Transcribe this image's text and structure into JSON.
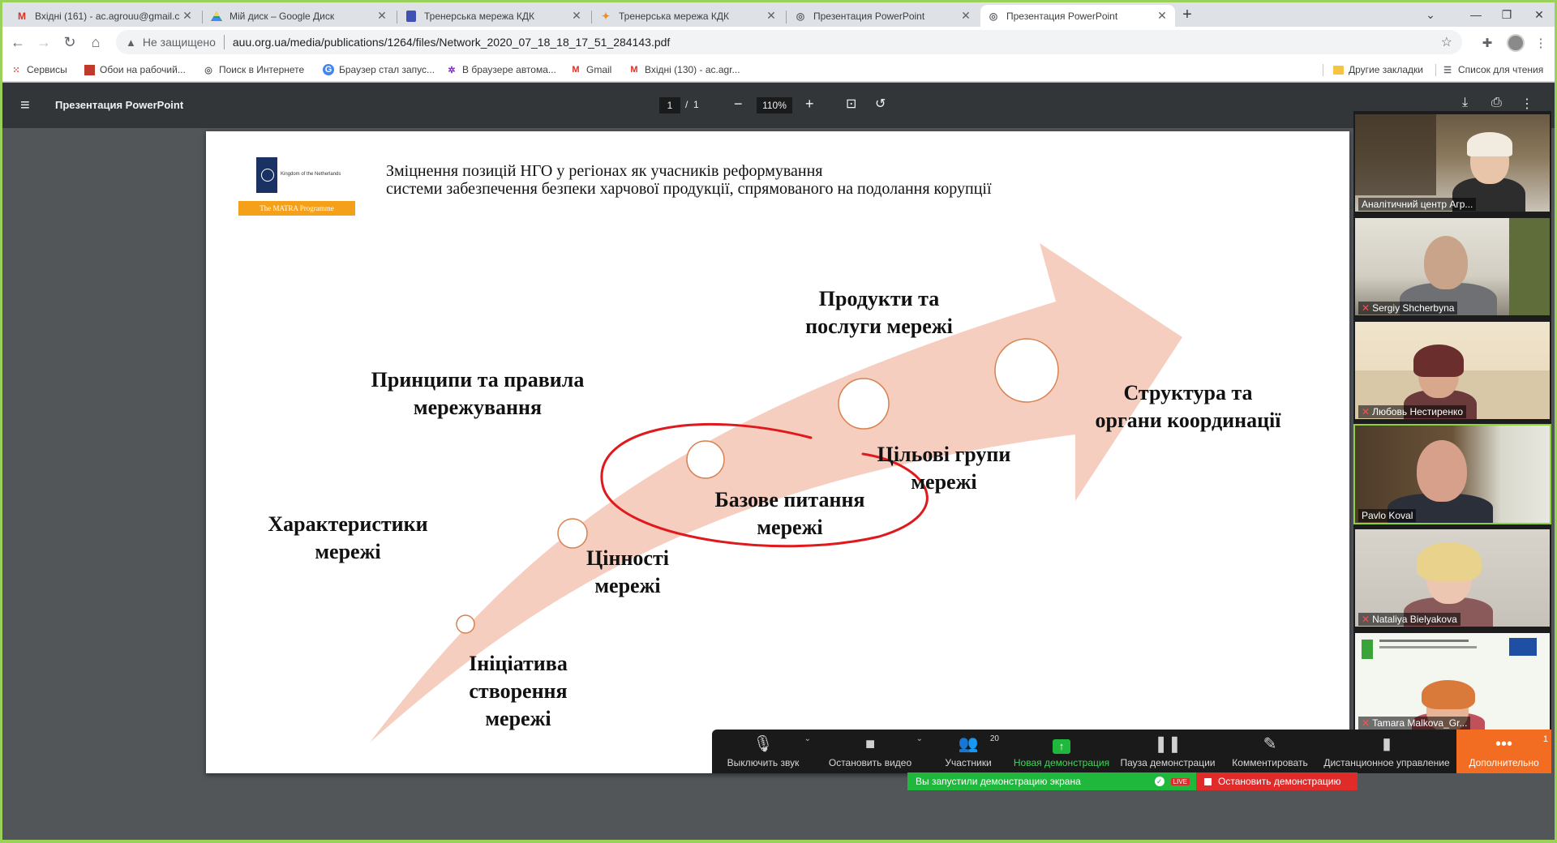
{
  "browser": {
    "tabs": [
      {
        "title": "Вхідні (161) - ac.agrouu@gmail.c",
        "icon": "gmail-icon"
      },
      {
        "title": "Мій диск – Google Диск",
        "icon": "google-drive-icon"
      },
      {
        "title": "Тренерська мережа КДК",
        "icon": "google-forms-icon"
      },
      {
        "title": "Тренерська мережа КДК",
        "icon": "site-icon"
      },
      {
        "title": "Презентация PowerPoint",
        "icon": "globe-icon"
      },
      {
        "title": "Презентация PowerPoint",
        "icon": "globe-icon"
      }
    ],
    "new_tab": "+",
    "security_label": "Не защищено",
    "url": "auu.org.ua/media/publications/1264/files/Network_2020_07_18_18_17_51_284143.pdf",
    "bookmarks": [
      {
        "label": "Сервисы",
        "icon": "apps-grid-icon"
      },
      {
        "label": "Обои на рабочий...",
        "icon": "bookmark-image-icon"
      },
      {
        "label": "Поиск в Интернете",
        "icon": "globe-icon"
      },
      {
        "label": "Браузер стал запус...",
        "icon": "google-icon"
      },
      {
        "label": "В браузере автома...",
        "icon": "virus-icon"
      },
      {
        "label": "Gmail",
        "icon": "gmail-icon"
      },
      {
        "label": "Вхідні (130) - ac.agr...",
        "icon": "gmail-icon"
      }
    ],
    "other_bookmarks": "Другие закладки",
    "reading_list": "Список для чтения"
  },
  "pdf_viewer": {
    "title": "Презентация PowerPoint",
    "page_current": "1",
    "page_sep": "/",
    "page_total": "1",
    "zoom": "110%"
  },
  "slide": {
    "header_line1": "Зміцнення позицій НГО у регіонах як учасників реформування",
    "header_line2": "системи забезпечення безпеки харчової продукції, спрямованого на подолання корупції",
    "logo_text": "Kingdom of the Netherlands",
    "logo_banner": "The MATRA Programme",
    "labels": {
      "initiative": "Ініціатива\nстворення\nмережі",
      "characteristics": "Характеристики\nмережі",
      "values": "Цінності\nмережі",
      "basic_nutrition": "Базове питання\nмережі",
      "principles": "Принципи та правила\nмережування",
      "target_groups": "Цільові групи\nмережі",
      "products": "Продукти та\nпослуги мережі",
      "structure": "Структура та\nоргани координації"
    }
  },
  "zoom": {
    "participants": [
      {
        "name": "Аналітичний центр Агр...",
        "muted": false
      },
      {
        "name": "Sergiy Shcherbyna",
        "muted": true
      },
      {
        "name": "Любовь Нестиренко",
        "muted": true
      },
      {
        "name": "Pavlo Koval",
        "muted": false
      },
      {
        "name": "Nataliya Bielyakova",
        "muted": true
      },
      {
        "name": "Tamara Malkova_Gr...",
        "muted": true
      }
    ],
    "controls": {
      "mute": "Выключить звук",
      "stop_video": "Остановить видео",
      "participants": "Участники",
      "participants_count": "20",
      "new_share": "Новая демонстрация",
      "pause_share": "Пауза демонстрации",
      "annotate": "Комментировать",
      "remote_control": "Дистанционное управление",
      "more": "Дополнительно",
      "more_badge": "1"
    },
    "share_notice": "Вы запустили демонстрацию экрана",
    "live_badge": "LIVE",
    "stop_share": "Остановить демонстрацию"
  }
}
